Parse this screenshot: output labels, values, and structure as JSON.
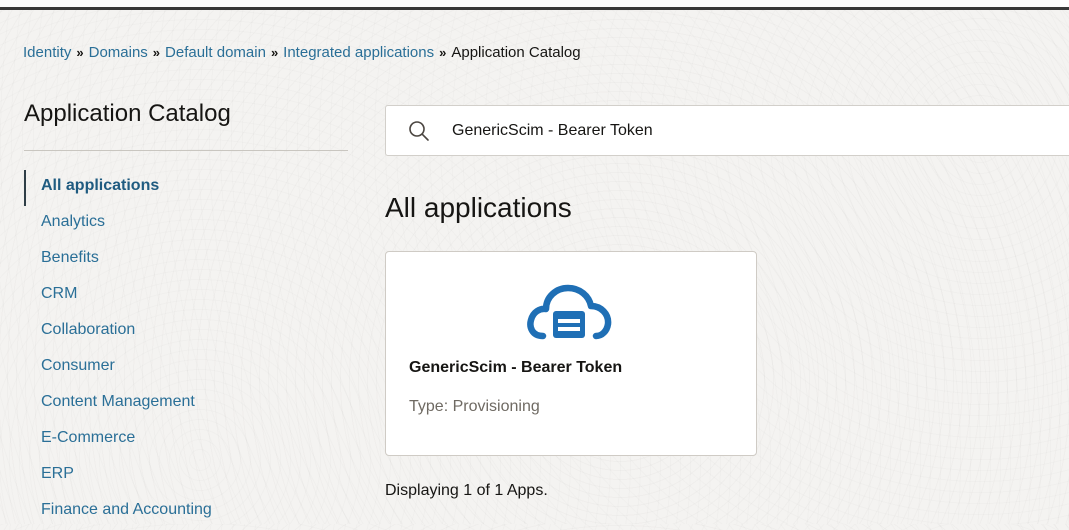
{
  "breadcrumb": {
    "items": [
      "Identity",
      "Domains",
      "Default domain",
      "Integrated applications"
    ],
    "current": "Application Catalog",
    "separator": "»"
  },
  "sidebar": {
    "title": "Application Catalog",
    "items": [
      {
        "label": "All applications",
        "active": true
      },
      {
        "label": "Analytics"
      },
      {
        "label": "Benefits"
      },
      {
        "label": "CRM"
      },
      {
        "label": "Collaboration"
      },
      {
        "label": "Consumer"
      },
      {
        "label": "Content Management"
      },
      {
        "label": "E-Commerce"
      },
      {
        "label": "ERP"
      },
      {
        "label": "Finance and Accounting"
      }
    ]
  },
  "search": {
    "value": "GenericScim - Bearer Token",
    "icon": "search-icon"
  },
  "main": {
    "heading": "All applications",
    "apps": [
      {
        "name": "GenericScim - Bearer Token",
        "type": "Type: Provisioning",
        "icon": "cloud-app-icon"
      }
    ],
    "results": "Displaying 1 of 1 Apps."
  },
  "colors": {
    "link": "#2a6f97",
    "icon_blue": "#1f6fb5",
    "background": "#f4f3f1",
    "text": "#161513"
  }
}
